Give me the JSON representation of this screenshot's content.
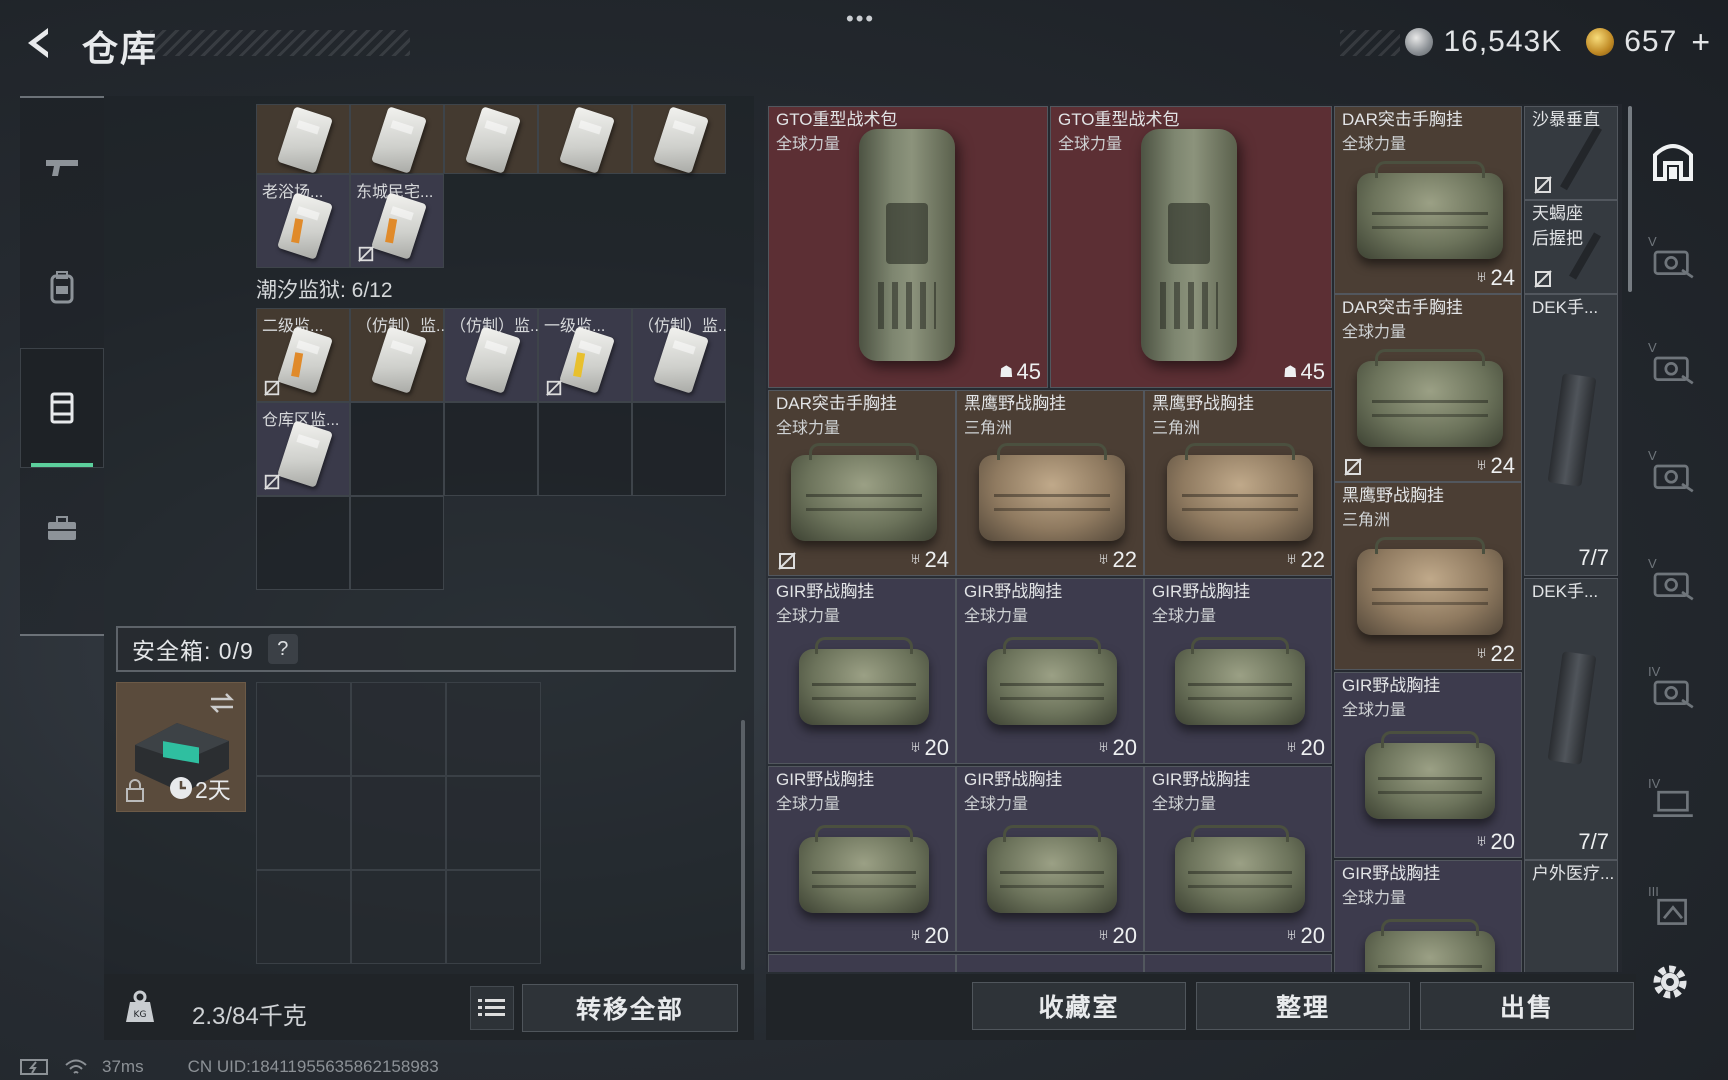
{
  "header": {
    "title": "仓库",
    "menu_dots": "•••",
    "silver_amount": "16,543K",
    "gold_amount": "657",
    "plus_label": "+"
  },
  "left_nav": {
    "items": [
      {
        "name": "weapons",
        "icon": "gun-icon",
        "active": false
      },
      {
        "name": "gear",
        "icon": "backpack-icon",
        "active": false
      },
      {
        "name": "containers",
        "icon": "container-icon",
        "active": true
      },
      {
        "name": "equipment",
        "icon": "briefcase-icon",
        "active": false
      }
    ]
  },
  "left_container": {
    "top_row_labels": [
      "",
      "",
      "",
      "",
      ""
    ],
    "row2_labels": [
      "老浴场...",
      "东城民宅..."
    ],
    "prison_label": "潮汐监狱: 6/12",
    "prison_row1": [
      "二级监...",
      "（仿制）监...",
      "（仿制）监...",
      "一级监...",
      "（仿制）监..."
    ],
    "prison_row2": [
      "仓库区监..."
    ],
    "safebox_label": "安全箱: 0/9",
    "safebox_help": "?",
    "safebox_timer": "2天",
    "weight": "2.3/84千克",
    "transfer_all": "转移全部"
  },
  "items": [
    {
      "name": "GTO重型战术包",
      "sub": "全球力量",
      "cap": "45"
    },
    {
      "name": "GTO重型战术包",
      "sub": "全球力量",
      "cap": "45"
    },
    {
      "name": "DAR突击手胸挂",
      "sub": "全球力量",
      "cap": "24"
    },
    {
      "name": "沙暴垂直",
      "sub": ""
    },
    {
      "name": "天蝎座",
      "sub": "后握把"
    },
    {
      "name": "DAR突击手胸挂",
      "sub": "全球力量",
      "cap": "24"
    },
    {
      "name": "DEK手...",
      "sub": "",
      "count": "7/7"
    },
    {
      "name": "DAR突击手胸挂",
      "sub": "全球力量",
      "cap": "24"
    },
    {
      "name": "黑鹰野战胸挂",
      "sub": "三角洲",
      "cap": "22"
    },
    {
      "name": "黑鹰野战胸挂",
      "sub": "三角洲",
      "cap": "22"
    },
    {
      "name": "黑鹰野战胸挂",
      "sub": "三角洲",
      "cap": "22"
    },
    {
      "name": "GIR野战胸挂",
      "sub": "全球力量",
      "cap": "20"
    },
    {
      "name": "GIR野战胸挂",
      "sub": "全球力量",
      "cap": "20"
    },
    {
      "name": "GIR野战胸挂",
      "sub": "全球力量",
      "cap": "20"
    },
    {
      "name": "DEK手...",
      "sub": "",
      "count": "7/7"
    },
    {
      "name": "GIR野战胸挂",
      "sub": "全球力量",
      "cap": "20"
    },
    {
      "name": "GIR野战胸挂",
      "sub": "全球力量",
      "cap": "20"
    },
    {
      "name": "GIR野战胸挂",
      "sub": "全球力量",
      "cap": "20"
    },
    {
      "name": "GIR野战胸挂",
      "sub": "全球力量",
      "cap": "20"
    },
    {
      "name": "GIR野战胸挂",
      "sub": "全球力量"
    },
    {
      "name": "户外医疗...",
      "sub": ""
    }
  ],
  "right_toolbar": {
    "levels": [
      "V",
      "V",
      "V",
      "V",
      "IV",
      "IV",
      "III"
    ]
  },
  "bottom_buttons": {
    "collection": "收藏室",
    "organize": "整理",
    "sell": "出售"
  },
  "status": {
    "ping": "37ms",
    "uid": "CN UID:18411955635862158983"
  }
}
